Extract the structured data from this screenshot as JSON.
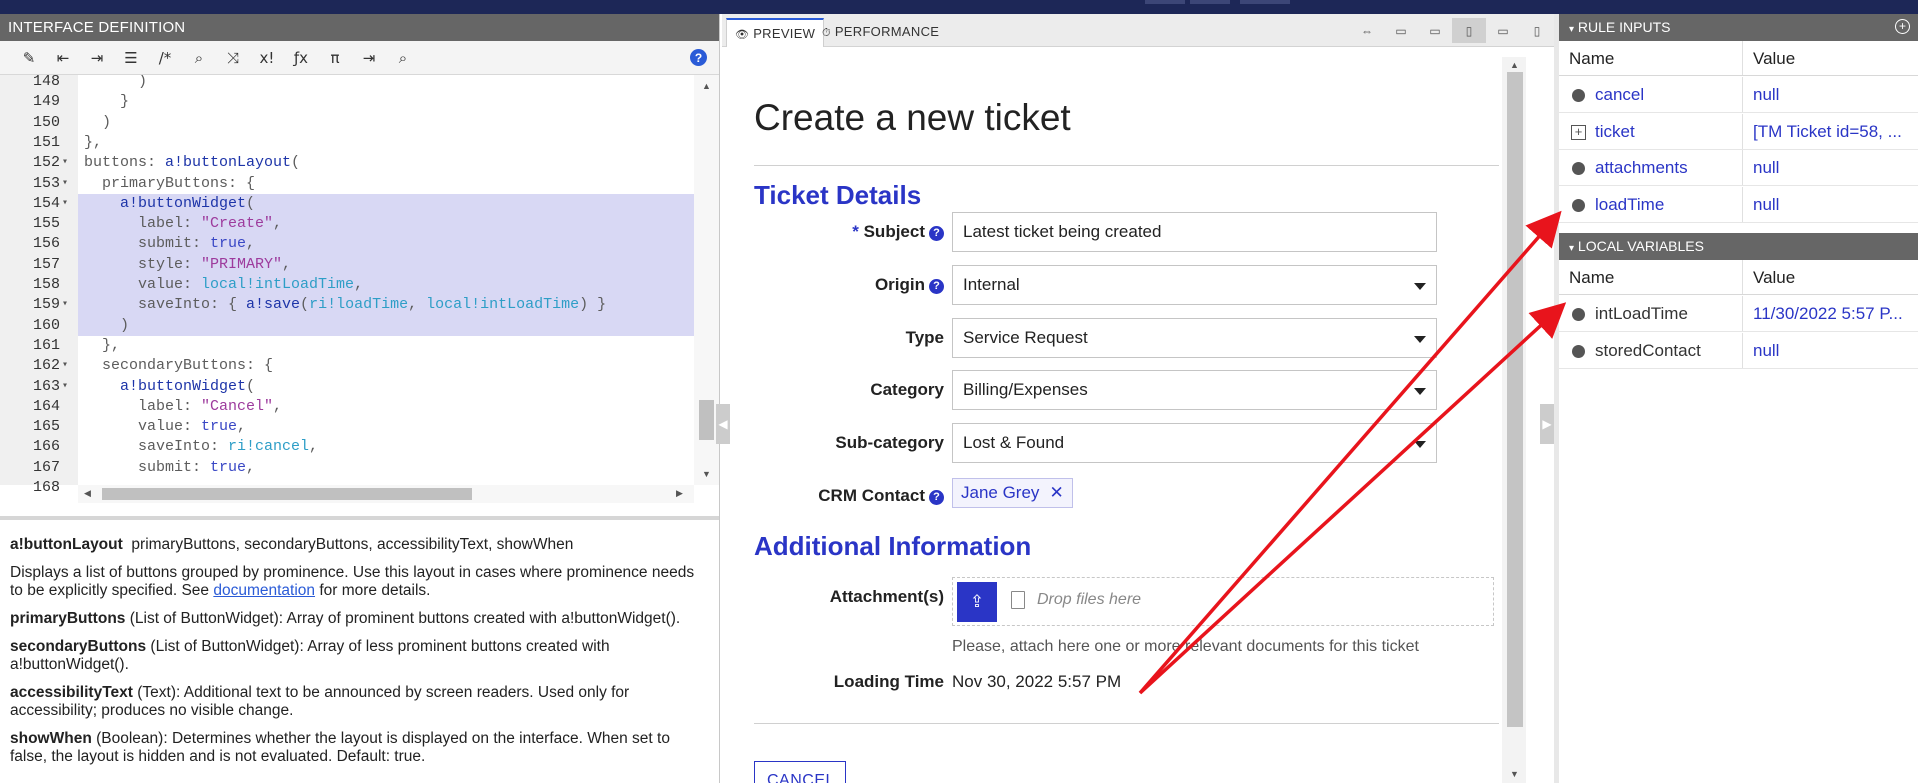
{
  "left_panel": {
    "title": "INTERFACE DEFINITION",
    "toolbar_icons": [
      "wand-icon",
      "outdent-icon",
      "indent-icon",
      "list-icon",
      "comment-icon",
      "search-icon",
      "shuffle-icon",
      "variable-icon",
      "function-icon",
      "pi-icon",
      "export-icon",
      "database-search-icon"
    ],
    "toolbar_glyphs": [
      "✎",
      "⇤",
      "⇥",
      "☰",
      "/*",
      "⌕",
      "⤨",
      "x!",
      "ƒx",
      "π",
      "⇥",
      "⌕"
    ],
    "help_glyph": "?",
    "code_lines": [
      {
        "num": "148",
        "fold": "",
        "html": "      )"
      },
      {
        "num": "149",
        "fold": "",
        "html": "    }"
      },
      {
        "num": "150",
        "fold": "",
        "html": "  )"
      },
      {
        "num": "151",
        "fold": "",
        "html": "},"
      },
      {
        "num": "152",
        "fold": "▾",
        "html": "buttons: <span class=\"kw\">a!buttonLayout</span>("
      },
      {
        "num": "153",
        "fold": "▾",
        "html": "  primaryButtons: {"
      },
      {
        "num": "154",
        "fold": "▾",
        "html": "    <span class=\"kw\">a!buttonWidget</span>(",
        "sel": true
      },
      {
        "num": "155",
        "fold": "",
        "html": "      label: <span class=\"str\">\"Create\"</span>,",
        "sel": true
      },
      {
        "num": "156",
        "fold": "",
        "html": "      submit: <span class=\"bool\">true</span>,",
        "sel": true
      },
      {
        "num": "157",
        "fold": "",
        "html": "      style: <span class=\"str\">\"PRIMARY\"</span>,",
        "sel": true
      },
      {
        "num": "158",
        "fold": "",
        "html": "      value: <span class=\"var\">local!intLoadTime</span>,",
        "sel": true
      },
      {
        "num": "159",
        "fold": "▾",
        "html": "      saveInto: { <span class=\"kw\">a!save</span>(<span class=\"var\">ri!loadTime</span>, <span class=\"var\">local!intLoadTime</span>) }",
        "sel": true
      },
      {
        "num": "160",
        "fold": "",
        "html": "    )",
        "sel": true
      },
      {
        "num": "161",
        "fold": "",
        "html": "  },"
      },
      {
        "num": "162",
        "fold": "▾",
        "html": "  secondaryButtons: {"
      },
      {
        "num": "163",
        "fold": "▾",
        "html": "    <span class=\"kw\">a!buttonWidget</span>("
      },
      {
        "num": "164",
        "fold": "",
        "html": "      label: <span class=\"str\">\"Cancel\"</span>,"
      },
      {
        "num": "165",
        "fold": "",
        "html": "      value: <span class=\"bool\">true</span>,"
      },
      {
        "num": "166",
        "fold": "",
        "html": "      saveInto: <span class=\"var\">ri!cancel</span>,"
      },
      {
        "num": "167",
        "fold": "",
        "html": "      submit: <span class=\"bool\">true</span>,"
      },
      {
        "num": "168",
        "fold": "",
        "html": ""
      }
    ],
    "doc": {
      "signature_name": "a!buttonLayout",
      "signature_params": "primaryButtons, secondaryButtons, accessibilityText, showWhen",
      "description_pre": "Displays a list of buttons grouped by prominence. Use this layout in cases where prominence needs to be explicitly specified. See",
      "description_link": "documentation",
      "description_post": "for more details.",
      "params": [
        {
          "name": "primaryButtons",
          "text": "(List of ButtonWidget): Array of prominent buttons created with a!buttonWidget()."
        },
        {
          "name": "secondaryButtons",
          "text": "(List of ButtonWidget): Array of less prominent buttons created with a!buttonWidget()."
        },
        {
          "name": "accessibilityText",
          "text": "(Text): Additional text to be announced by screen readers. Used only for accessibility; produces no visible change."
        },
        {
          "name": "showWhen",
          "text": "(Boolean): Determines whether the layout is displayed on the interface. When set to false, the layout is hidden and is not evaluated. Default: true."
        }
      ]
    }
  },
  "center_panel": {
    "tab_preview": "PREVIEW",
    "tab_performance": "PERFORMANCE",
    "tab_preview_icon": "👁",
    "tab_performance_icon": "⏱",
    "device_icons": [
      "fit-width-icon",
      "desktop-wide-icon",
      "desktop-icon",
      "tablet-landscape-icon",
      "tablet-portrait-icon",
      "phone-icon"
    ],
    "form": {
      "title": "Create a new ticket",
      "section_details": "Ticket Details",
      "section_additional": "Additional Information",
      "required_mark": "*",
      "help_glyph": "?",
      "subject_label": "Subject",
      "subject_value": "Latest ticket being created",
      "origin_label": "Origin",
      "origin_value": "Internal",
      "type_label": "Type",
      "type_value": "Service Request",
      "category_label": "Category",
      "category_value": "Billing/Expenses",
      "subcategory_label": "Sub-category",
      "subcategory_value": "Lost & Found",
      "crm_label": "CRM Contact",
      "crm_value": "Jane Grey",
      "crm_remove": "✕",
      "attachments_label": "Attachment(s)",
      "drop_placeholder": "Drop files here",
      "attachments_helper": "Please, attach here one or more relevant documents for this ticket",
      "loading_label": "Loading Time",
      "loading_value": "Nov 30, 2022 5:57 PM",
      "cancel_label": "CANCEL"
    }
  },
  "right_panel": {
    "rule_inputs_title": "RULE INPUTS",
    "local_vars_title": "LOCAL VARIABLES",
    "col_name": "Name",
    "col_value": "Value",
    "rule_inputs": [
      {
        "name": "cancel",
        "value": "null",
        "marker": "dot"
      },
      {
        "name": "ticket",
        "value": "[TM Ticket id=58, ...",
        "marker": "box"
      },
      {
        "name": "attachments",
        "value": "null",
        "marker": "dot"
      },
      {
        "name": "loadTime",
        "value": "null",
        "marker": "dot"
      }
    ],
    "local_variables": [
      {
        "name": "intLoadTime",
        "value": "11/30/2022 5:57 P..."
      },
      {
        "name": "storedContact",
        "value": "null"
      }
    ]
  },
  "colors": {
    "accent": "#2a35c6",
    "annotation_arrow": "#e8141c",
    "panel_header": "#666666",
    "selection": "#d8d8f4"
  }
}
